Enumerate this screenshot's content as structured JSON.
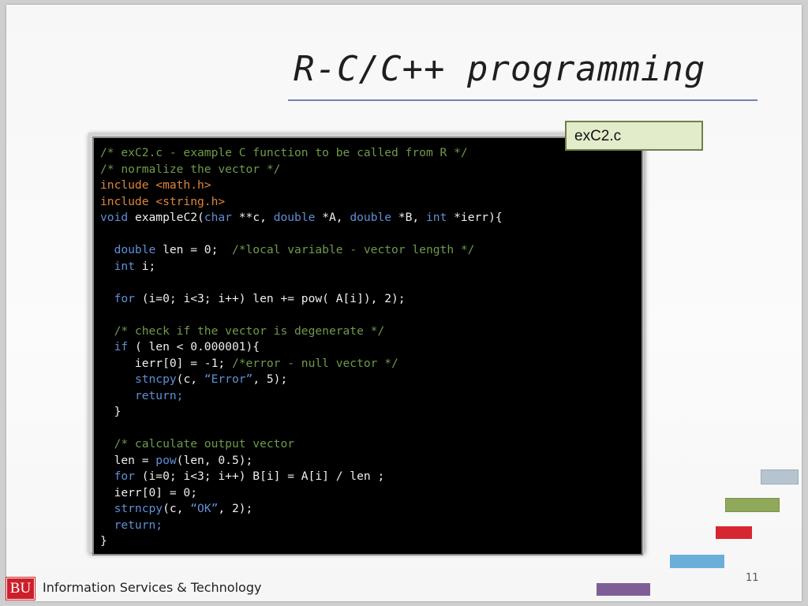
{
  "slide": {
    "title": "R-C/C++ programming",
    "callout_label": "exC2.c",
    "page_number": "11",
    "footer": {
      "logo_text": "BU",
      "org_text": "Information Services & Technology"
    }
  },
  "colors": {
    "comment": "#6f9a4b",
    "keyword": "#5f8fd6",
    "include": "#e0853b",
    "plain": "#eeeeee",
    "code_background": "#000000",
    "callout_background": "#e2ecca",
    "deco_gray_blue": "#b6c4cf",
    "deco_green": "#8fa85a",
    "deco_red": "#d82631",
    "deco_blue": "#6aaed9",
    "deco_purple": "#7f5e98"
  },
  "code_lines": [
    [
      [
        "comment",
        "/* exC2.c - example C function to be called from R */"
      ]
    ],
    [
      [
        "comment",
        "/* normalize the vector */"
      ]
    ],
    [
      [
        "incl",
        "include <math.h>"
      ]
    ],
    [
      [
        "incl",
        "include <string.h>"
      ]
    ],
    [
      [
        "kw",
        "void"
      ],
      [
        "plain",
        " exampleC2("
      ],
      [
        "kw",
        "char"
      ],
      [
        "plain",
        " **c, "
      ],
      [
        "kw",
        "double"
      ],
      [
        "plain",
        " *A, "
      ],
      [
        "kw",
        "double"
      ],
      [
        "plain",
        " *B, "
      ],
      [
        "kw",
        "int"
      ],
      [
        "plain",
        " *ierr){"
      ]
    ],
    [
      [
        "plain",
        ""
      ]
    ],
    [
      [
        "plain",
        "  "
      ],
      [
        "kw",
        "double"
      ],
      [
        "plain",
        " len = 0;  "
      ],
      [
        "comment",
        "/*local variable - vector length */"
      ]
    ],
    [
      [
        "plain",
        "  "
      ],
      [
        "kw",
        "int"
      ],
      [
        "plain",
        " i;"
      ]
    ],
    [
      [
        "plain",
        ""
      ]
    ],
    [
      [
        "plain",
        "  "
      ],
      [
        "kw",
        "for"
      ],
      [
        "plain",
        " (i=0; i<3; i++) len += pow( A[i]), 2);"
      ]
    ],
    [
      [
        "plain",
        ""
      ]
    ],
    [
      [
        "plain",
        "  "
      ],
      [
        "comment",
        "/* check if the vector is degenerate */"
      ]
    ],
    [
      [
        "plain",
        "  "
      ],
      [
        "kw",
        "if"
      ],
      [
        "plain",
        " ( len < 0.000001){"
      ]
    ],
    [
      [
        "plain",
        "     ierr[0] = -1; "
      ],
      [
        "comment",
        "/*error - null vector */"
      ]
    ],
    [
      [
        "plain",
        "     "
      ],
      [
        "kw",
        "stncpy"
      ],
      [
        "plain",
        "(c, "
      ],
      [
        "str",
        "“Error”"
      ],
      [
        "plain",
        ", 5);"
      ]
    ],
    [
      [
        "plain",
        "     "
      ],
      [
        "kw",
        "return;"
      ]
    ],
    [
      [
        "plain",
        "  }"
      ]
    ],
    [
      [
        "plain",
        ""
      ]
    ],
    [
      [
        "plain",
        "  "
      ],
      [
        "comment",
        "/* calculate output vector"
      ]
    ],
    [
      [
        "plain",
        "  len = "
      ],
      [
        "kw",
        "pow"
      ],
      [
        "plain",
        "(len, 0.5);"
      ]
    ],
    [
      [
        "plain",
        "  "
      ],
      [
        "kw",
        "for"
      ],
      [
        "plain",
        " (i=0; i<3; i++) B[i] = A[i] / len ;"
      ]
    ],
    [
      [
        "plain",
        "  ierr[0] = 0;"
      ]
    ],
    [
      [
        "plain",
        "  "
      ],
      [
        "kw",
        "strncpy"
      ],
      [
        "plain",
        "(c, "
      ],
      [
        "str",
        "“OK”"
      ],
      [
        "plain",
        ", 2);"
      ]
    ],
    [
      [
        "plain",
        "  "
      ],
      [
        "kw",
        "return;"
      ]
    ],
    [
      [
        "plain",
        "}"
      ]
    ]
  ]
}
